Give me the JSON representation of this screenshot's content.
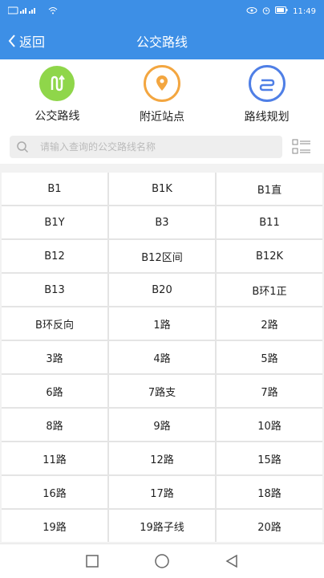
{
  "status": {
    "time": "11:49"
  },
  "header": {
    "back_label": "返回",
    "title": "公交路线"
  },
  "features": [
    {
      "label": "公交路线",
      "icon": "bus-route-icon",
      "color": "#7ccf3c"
    },
    {
      "label": "附近站点",
      "icon": "location-pin-icon",
      "color": "#f3a640"
    },
    {
      "label": "路线规划",
      "icon": "route-plan-icon",
      "color": "#4f7fe6"
    }
  ],
  "search": {
    "placeholder": "请输入查询的公交路线名称"
  },
  "routes": [
    "B1",
    "B1K",
    "B1直",
    "B1Y",
    "B3",
    "B11",
    "B12",
    "B12区间",
    "B12K",
    "B13",
    "B20",
    "B环1正",
    "B环反向",
    "1路",
    "2路",
    "3路",
    "4路",
    "5路",
    "6路",
    "7路支",
    "7路",
    "8路",
    "9路",
    "10路",
    "11路",
    "12路",
    "15路",
    "16路",
    "17路",
    "18路",
    "19路",
    "19路子线",
    "20路"
  ],
  "colors": {
    "accent": "#3d8fe6"
  }
}
